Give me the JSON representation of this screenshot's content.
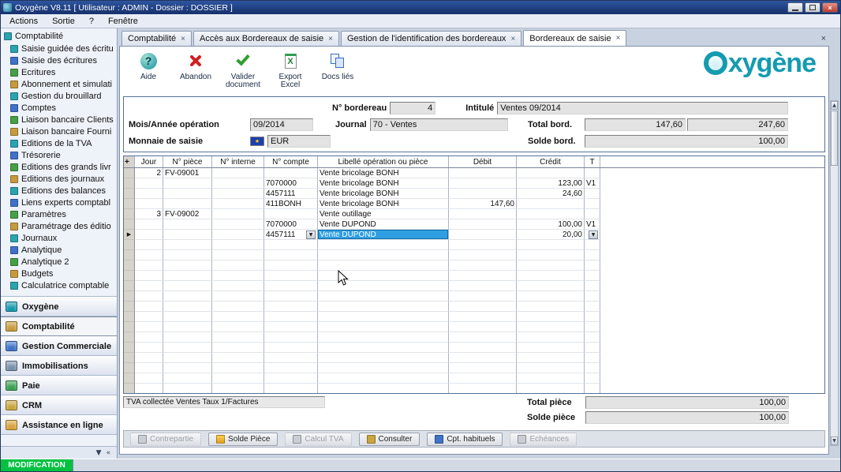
{
  "window": {
    "title": "Oxygène V8.11 [ Utilisateur : ADMIN - Dossier : DOSSIER ]",
    "menu": [
      "Actions",
      "Sortie",
      "?",
      "Fenêtre"
    ]
  },
  "icons": {
    "close": "×",
    "dropdown": "▼",
    "row_pointer": "▶",
    "scroll_up": "▲",
    "scroll_down": "▼",
    "add": "+",
    "pin": "▼",
    "collapse": "«",
    "flag_star": "★",
    "help": "?",
    "excel_x": "X"
  },
  "sidebar": {
    "header": "Comptabilité",
    "items": [
      {
        "label": "Saisie guidée des écritu"
      },
      {
        "label": "Saisie des écritures"
      },
      {
        "label": "Ecritures"
      },
      {
        "label": "Abonnement et simulati"
      },
      {
        "label": "Gestion du brouillard"
      },
      {
        "label": "Comptes"
      },
      {
        "label": "Liaison bancaire Clients"
      },
      {
        "label": "Liaison bancaire Fourni"
      },
      {
        "label": "Editions de la TVA"
      },
      {
        "label": "Trésorerie"
      },
      {
        "label": "Editions des grands livr"
      },
      {
        "label": "Editions des journaux"
      },
      {
        "label": "Editions des balances"
      },
      {
        "label": "Liens experts comptabl"
      },
      {
        "label": "Paramètres"
      },
      {
        "label": "Paramétrage des éditio"
      },
      {
        "label": "Journaux"
      },
      {
        "label": "Analytique"
      },
      {
        "label": "Analytique 2"
      },
      {
        "label": "Budgets"
      },
      {
        "label": "Calculatrice comptable"
      }
    ],
    "sections": [
      {
        "label": "Oxygène",
        "icon": "oxygene-icon",
        "icon_color": "#1599ad",
        "active": false
      },
      {
        "label": "Comptabilité",
        "icon": "accounting-icon",
        "icon_color": "#c79b3b",
        "active": true
      },
      {
        "label": "Gestion Commerciale",
        "icon": "commerce-icon",
        "icon_color": "#3f72c8",
        "active": false
      },
      {
        "label": "Immobilisations",
        "icon": "assets-icon",
        "icon_color": "#7a8faa",
        "active": false
      },
      {
        "label": "Paie",
        "icon": "payroll-icon",
        "icon_color": "#3aa053",
        "active": false
      },
      {
        "label": "CRM",
        "icon": "crm-icon",
        "icon_color": "#caa53f",
        "active": false
      },
      {
        "label": "Assistance en ligne",
        "icon": "support-icon",
        "icon_color": "#d8a23c",
        "active": false
      }
    ]
  },
  "status": {
    "mode": "MODIFICATION"
  },
  "tabs": [
    {
      "label": "Comptabilité",
      "active": false
    },
    {
      "label": "Accès aux Bordereaux de saisie",
      "active": false
    },
    {
      "label": "Gestion de l'identification des bordereaux",
      "active": false
    },
    {
      "label": "Bordereaux de saisie",
      "active": true
    }
  ],
  "toolbar": {
    "buttons": [
      {
        "label": "Aide",
        "icon": "help-icon"
      },
      {
        "label": "Abandon",
        "icon": "abort-icon"
      },
      {
        "label": "Valider document",
        "icon": "validate-icon"
      },
      {
        "label": "Export Excel",
        "icon": "excel-icon"
      },
      {
        "label": "Docs liés",
        "icon": "linked-docs-icon"
      }
    ],
    "logo": "oxygène"
  },
  "form": {
    "bordereau_label": "N° bordereau",
    "bordereau_value": "4",
    "intitule_label": "Intitulé",
    "intitule_value": "Ventes 09/2014",
    "mois_label": "Mois/Année opération",
    "mois_value": "09/2014",
    "journal_label": "Journal",
    "journal_value": "70 - Ventes",
    "total_label": "Total bord.",
    "total_value1": "147,60",
    "total_value2": "247,60",
    "monnaie_label": "Monnaie de saisie",
    "monnaie_value": "EUR",
    "solde_label": "Solde bord.",
    "solde_value": "100,00"
  },
  "table": {
    "corner": "+",
    "headers": [
      "Jour",
      "N° pièce",
      "N° interne",
      "N° compte",
      "Libellé opération ou pièce",
      "Débit",
      "Crédit",
      "T"
    ],
    "rows": [
      {
        "jour": "2",
        "piece": "FV-09001",
        "interne": "",
        "compte": "",
        "libelle": "Vente bricolage BONH",
        "debit": "",
        "credit": "",
        "t": ""
      },
      {
        "jour": "",
        "piece": "",
        "interne": "",
        "compte": "7070000",
        "libelle": "Vente bricolage BONH",
        "debit": "",
        "credit": "123,00",
        "t": "V1"
      },
      {
        "jour": "",
        "piece": "",
        "interne": "",
        "compte": "4457111",
        "libelle": "Vente bricolage BONH",
        "debit": "",
        "credit": "24,60",
        "t": ""
      },
      {
        "jour": "",
        "piece": "",
        "interne": "",
        "compte": "411BONH",
        "libelle": "Vente bricolage BONH",
        "debit": "147,60",
        "credit": "",
        "t": ""
      },
      {
        "jour": "3",
        "piece": "FV-09002",
        "interne": "",
        "compte": "",
        "libelle": "Vente outillage",
        "debit": "",
        "credit": "",
        "t": ""
      },
      {
        "jour": "",
        "piece": "",
        "interne": "",
        "compte": "7070000",
        "libelle": "Vente DUPOND",
        "debit": "",
        "credit": "100,00",
        "t": "V1"
      },
      {
        "jour": "",
        "piece": "",
        "interne": "",
        "compte": "4457111",
        "libelle": "Vente DUPOND",
        "debit": "",
        "credit": "20,00",
        "t": "",
        "active": true,
        "selected": true
      }
    ],
    "footer_note": "TVA collectée Ventes Taux 1/Factures"
  },
  "totals": {
    "total_piece_label": "Total pièce",
    "total_piece_value": "100,00",
    "solde_piece_label": "Solde pièce",
    "solde_piece_value": "100,00"
  },
  "actions": [
    {
      "label": "Contrepartie",
      "icon": "counterpart-icon",
      "enabled": false
    },
    {
      "label": "Solde Pièce",
      "icon": "balance-icon",
      "icon_class": "ai-balance",
      "enabled": true
    },
    {
      "label": "Calcul TVA",
      "icon": "vat-calc-icon",
      "enabled": false
    },
    {
      "label": "Consulter",
      "icon": "binoculars-icon",
      "icon_class": "ai-binoculars",
      "enabled": true
    },
    {
      "label": "Cpt. habituels",
      "icon": "usual-accounts-icon",
      "icon_class": "ai-accounts",
      "enabled": true
    },
    {
      "label": "Echéances",
      "icon": "schedule-icon",
      "enabled": false
    }
  ]
}
